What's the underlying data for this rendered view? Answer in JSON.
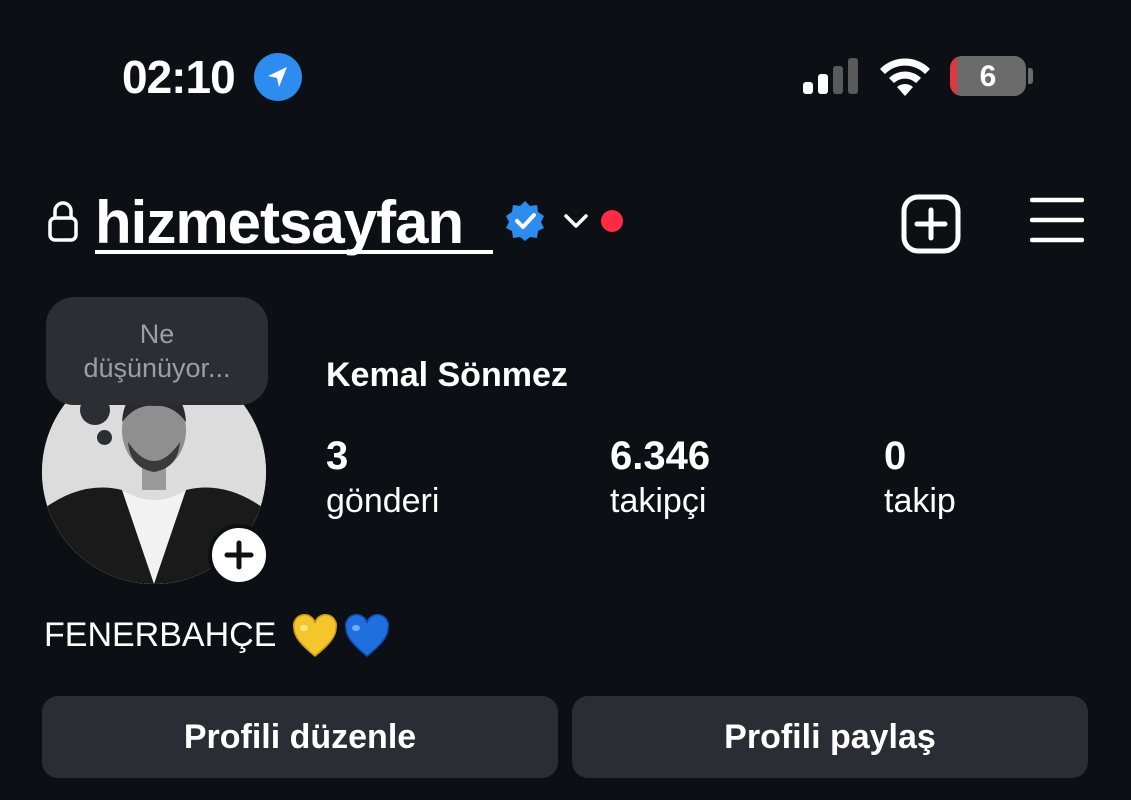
{
  "status_bar": {
    "time": "02:10",
    "battery_level": "6",
    "location_icon": "location-arrow-icon",
    "signal_icon": "cellular-signal-icon",
    "wifi_icon": "wifi-icon",
    "battery_icon": "battery-icon"
  },
  "header": {
    "username": "hizmetsayfan",
    "lock_icon": "lock-icon",
    "verified_icon": "verified-badge-icon",
    "switcher_icon": "chevron-down-icon",
    "notification_dot_color": "#ff2a45",
    "new_post_icon": "plus-square-icon",
    "menu_icon": "hamburger-menu-icon"
  },
  "profile": {
    "note_bubble": "Ne düşünüyor...",
    "full_name": "Kemal Sönmez",
    "add_story_icon": "plus-icon",
    "stats": {
      "posts": {
        "count": "3",
        "label": "gönderi"
      },
      "followers": {
        "count": "6.346",
        "label": "takipçi"
      },
      "following": {
        "count": "0",
        "label": "takip"
      }
    },
    "bio": "FENERBAHÇE",
    "bio_emojis": [
      "yellow-heart-icon",
      "blue-heart-icon"
    ]
  },
  "actions": {
    "edit_profile": "Profili düzenle",
    "share_profile": "Profili paylaş"
  },
  "colors": {
    "background": "#0c0f14",
    "button_bg": "#2a2d33",
    "accent_blue": "#2d8cf0"
  }
}
